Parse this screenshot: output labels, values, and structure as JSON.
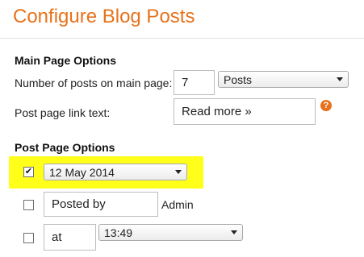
{
  "page": {
    "title": "Configure Blog Posts"
  },
  "main_page_options": {
    "heading": "Main Page Options",
    "posts_count_label": "Number of posts on main page:",
    "posts_count_value": "7",
    "posts_unit_selected": "Posts",
    "link_text_label": "Post page link text:",
    "link_text_value": "Read more »",
    "help_icon_glyph": "?"
  },
  "post_page_options": {
    "heading": "Post Page Options",
    "date_row": {
      "checked": true,
      "check_glyph": "✔",
      "date_selected": "12 May 2014"
    },
    "author_row": {
      "checked": false,
      "prefix_value": "Posted by",
      "author_name": "Admin"
    },
    "time_row": {
      "checked": false,
      "prefix_value": "at",
      "time_selected": "13:49"
    }
  },
  "colors": {
    "accent": "#e8721b",
    "highlight": "#ffff1a"
  },
  "icons": {
    "help": "help-icon",
    "dropdown": "chevron-down-icon"
  }
}
